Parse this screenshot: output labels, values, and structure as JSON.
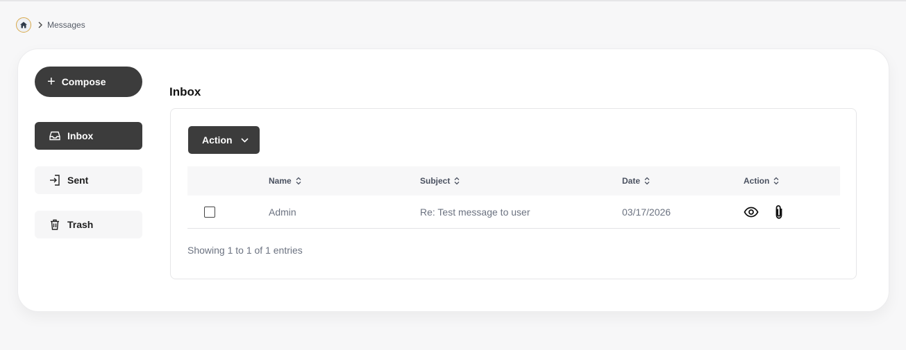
{
  "breadcrumb": {
    "home_icon": "home-icon",
    "separator_icon": "chevron-right-icon",
    "current": "Messages"
  },
  "sidebar": {
    "compose_label": "Compose",
    "items": [
      {
        "label": "Inbox",
        "icon": "inbox-icon",
        "active": true
      },
      {
        "label": "Sent",
        "icon": "sent-icon",
        "active": false
      },
      {
        "label": "Trash",
        "icon": "trash-icon",
        "active": false
      }
    ]
  },
  "main": {
    "title": "Inbox",
    "action_button": "Action",
    "table": {
      "columns": [
        "Name",
        "Subject",
        "Date",
        "Action"
      ],
      "rows": [
        {
          "checked": false,
          "name": "Admin",
          "subject": "Re: Test message to user",
          "date": "03/17/2026",
          "actions": [
            "eye-icon",
            "paperclip-icon"
          ]
        }
      ]
    },
    "footer": "Showing 1 to 1 of 1 entries"
  },
  "colors": {
    "primary_dark": "#3c3c3c",
    "home_ring": "#d9a94a",
    "background": "#f7f7f8"
  }
}
